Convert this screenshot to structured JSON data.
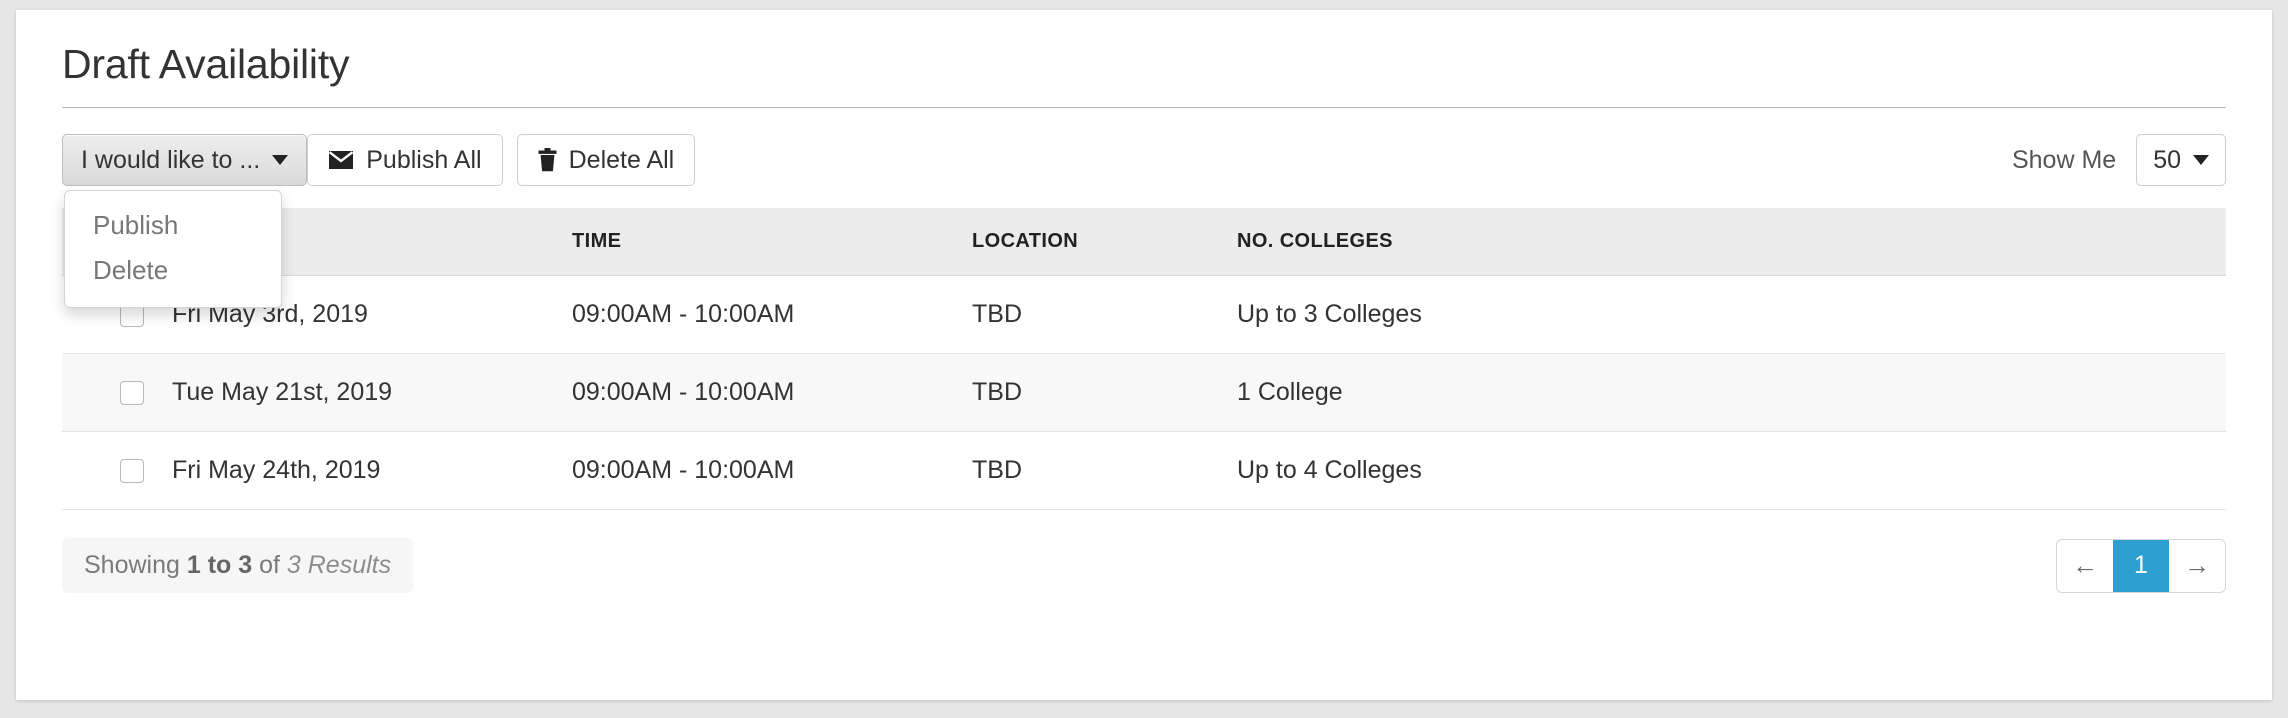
{
  "page": {
    "title": "Draft Availability"
  },
  "toolbar": {
    "dropdown": {
      "label": "I would like to ...",
      "caret_icon": "caret-down-icon",
      "items": [
        {
          "label": "Publish"
        },
        {
          "label": "Delete"
        }
      ]
    },
    "publish_all": {
      "label": "Publish All",
      "icon": "envelope-icon"
    },
    "delete_all": {
      "label": "Delete All",
      "icon": "trash-icon"
    },
    "show_me_label": "Show Me",
    "per_page_value": "50",
    "per_page_caret_icon": "caret-down-icon"
  },
  "table": {
    "columns": [
      "",
      "",
      "TIME",
      "LOCATION",
      "NO. COLLEGES"
    ],
    "rows": [
      {
        "checked": false,
        "date": "Fri May 3rd, 2019",
        "time": "09:00AM - 10:00AM",
        "location": "TBD",
        "colleges": "Up to 3 Colleges"
      },
      {
        "checked": false,
        "date": "Tue May 21st, 2019",
        "time": "09:00AM - 10:00AM",
        "location": "TBD",
        "colleges": "1 College"
      },
      {
        "checked": false,
        "date": "Fri May 24th, 2019",
        "time": "09:00AM - 10:00AM",
        "location": "TBD",
        "colleges": "Up to 4 Colleges"
      }
    ]
  },
  "footer": {
    "showing_prefix": "Showing ",
    "showing_range": "1 to 3",
    "showing_mid": " of ",
    "showing_total": "3 Results",
    "pager": {
      "prev_icon": "arrow-left-icon",
      "prev_label": "←",
      "current_page": "1",
      "next_icon": "arrow-right-icon",
      "next_label": "→"
    }
  },
  "colors": {
    "accent": "#2d9fd0",
    "page_bg": "#e6e6e6",
    "card_bg": "#ffffff",
    "header_bg": "#ececec",
    "row_alt_bg": "#f8f8f8"
  }
}
